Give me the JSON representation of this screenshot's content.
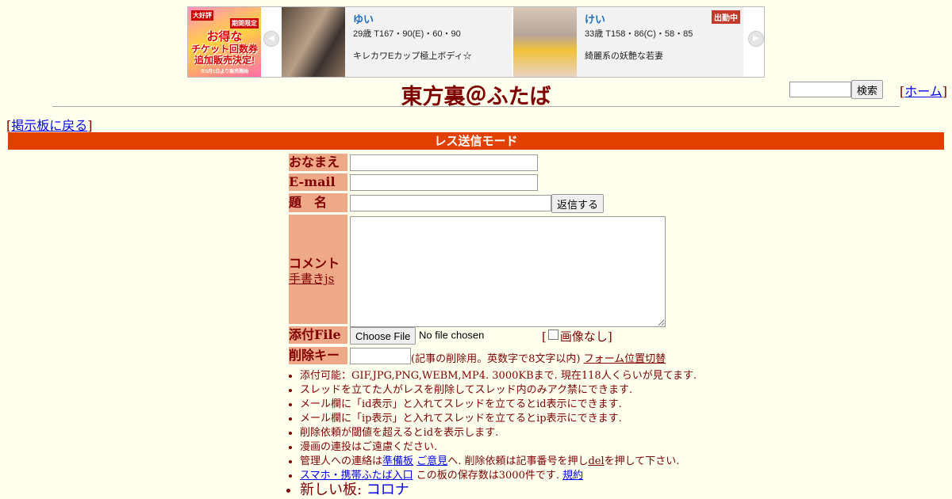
{
  "ad": {
    "promo": {
      "tag_top": "大好評",
      "tag_limited": "期間限定",
      "line1": "お得な",
      "line2": "チケット回数券",
      "line3": "追加販売決定!",
      "footer": "※5月1日より販売開始"
    },
    "cards": [
      {
        "name": "ゆい",
        "spec": "29歳 T167・90(E)・60・90",
        "desc": "キレカワEカップ極上ボディ☆",
        "badge": ""
      },
      {
        "name": "けい",
        "spec": "33歳 T158・86(C)・58・85",
        "desc": "綺麗系の妖艶な若妻",
        "badge": "出勤中"
      }
    ]
  },
  "header": {
    "title": "東方裏＠ふたば",
    "search_button": "検索",
    "home_open": "[",
    "home_link": "ホーム",
    "home_close": "]"
  },
  "nav": {
    "back_open": "[",
    "back_link": "掲示板に戻る",
    "back_close": "]"
  },
  "mode_bar": "レス送信モード",
  "form": {
    "name_label": "おなまえ",
    "email_label": "E-mail",
    "subject_label": "題　名",
    "submit_button": "返信する",
    "comment_label": "コメント",
    "handwriting_link": "手書きjs",
    "file_label": "添付File",
    "choose_file_button": "Choose File",
    "no_file_text": "No file chosen",
    "no_image_label": "画像なし",
    "bracket_open": "[",
    "bracket_close": "]",
    "delete_key_label": "削除キー",
    "delete_key_note": "(記事の削除用。英数字で8文字以内)",
    "form_position_link": "フォーム位置切替"
  },
  "rules": {
    "r1": "添付可能：GIF,JPG,PNG,WEBM,MP4. 3000KBまで. 現在118人くらいが見てます.",
    "r2": "スレッドを立てた人がレスを削除してスレッド内のみアク禁にできます.",
    "r3": "メール欄に「id表示」と入れてスレッドを立てるとid表示にできます.",
    "r4": "メール欄に「ip表示」と入れてスレッドを立てるとip表示にできます.",
    "r5": "削除依頼が閾値を超えるとidを表示します.",
    "r6": "漫画の連投はご遠慮ください.",
    "r7_prefix": "管理人への連絡は",
    "r7_link1": "準備板",
    "r7_space": " ",
    "r7_link2": "ご意見",
    "r7_mid": "へ. 削除依頼は記事番号を押し",
    "r7_link3": "del",
    "r7_suffix": "を押して下さい.",
    "r8_link1": "スマホ・携帯ふたば入口",
    "r8_mid": " この板の保存数は3000件です. ",
    "r8_link2": "規約",
    "new_board_label": "新しい板: ",
    "new_board_link": "コロナ"
  }
}
